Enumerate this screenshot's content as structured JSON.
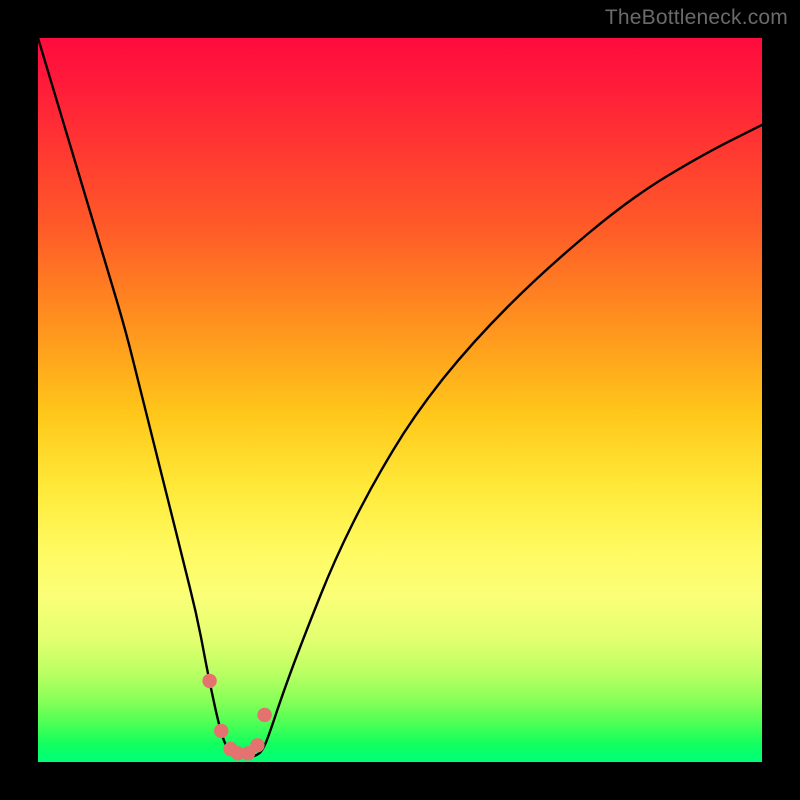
{
  "watermark": "TheBottleneck.com",
  "colors": {
    "marker": "#e4736f",
    "curve": "#000000"
  },
  "chart_data": {
    "type": "line",
    "title": "",
    "xlabel": "",
    "ylabel": "",
    "xlim": [
      0,
      100
    ],
    "ylim": [
      0,
      100
    ],
    "grid": false,
    "legend": false,
    "series": [
      {
        "name": "bottleneck-curve",
        "x": [
          0,
          3,
          6,
          9,
          12,
          14,
          16,
          18,
          20,
          22,
          23.5,
          25,
          26,
          27,
          28,
          29,
          30,
          31,
          32,
          34,
          37,
          41,
          46,
          52,
          60,
          70,
          82,
          92,
          100
        ],
        "y": [
          100,
          90,
          80,
          70,
          60,
          52,
          44,
          36,
          28,
          20,
          12,
          5,
          2,
          1,
          0.7,
          0.7,
          0.8,
          1.5,
          4,
          10,
          18,
          28,
          38,
          48,
          58,
          68,
          78,
          84,
          88
        ]
      }
    ],
    "markers": {
      "name": "highlighted-points",
      "x": [
        23.7,
        25.3,
        26.6,
        27.6,
        29.0,
        30.3,
        31.3
      ],
      "y": [
        11.2,
        4.3,
        1.8,
        1.2,
        1.2,
        2.3,
        6.5
      ]
    }
  }
}
